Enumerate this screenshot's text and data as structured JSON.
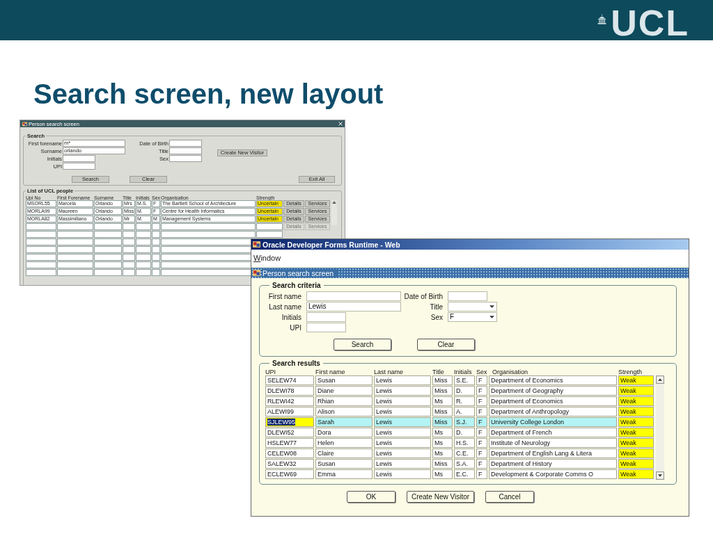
{
  "slide": {
    "logo": "UCL",
    "title": "Search screen, new layout"
  },
  "old_window": {
    "title": "Person search screen",
    "search": {
      "legend": "Search",
      "left_fields": [
        {
          "label": "First forename",
          "value": "m*",
          "kind": "long"
        },
        {
          "label": "Surname",
          "value": "orlando",
          "kind": "long"
        },
        {
          "label": "Initials",
          "kind": "short"
        },
        {
          "label": "UPI",
          "kind": "short"
        }
      ],
      "right_fields": [
        {
          "label": "Date of Birth",
          "kind": "short"
        },
        {
          "label": "Title",
          "kind": "short"
        },
        {
          "label": "Sex",
          "kind": "short"
        }
      ],
      "side_button": "Create New Visitor",
      "buttons": [
        "Search",
        "Clear"
      ],
      "exit_button": "Exit All"
    },
    "list": {
      "legend": "List of UCL people",
      "columns": [
        "Upi No",
        "First Forename",
        "Surname",
        "Title",
        "Initials",
        "Sex",
        "Organisation",
        "Strength"
      ],
      "rows": [
        {
          "cells": [
            "MSORL55",
            "Marcela",
            "Orlando",
            "Mrs",
            "M.S.",
            "F",
            "The Bartlett School of Architecture",
            "Uncertain"
          ],
          "actions": [
            {
              "label": "Details",
              "disabled": false
            },
            {
              "label": "Services",
              "disabled": false
            }
          ]
        },
        {
          "cells": [
            "MORLA99",
            "Maureen",
            "Orlando",
            "Miss",
            "M.",
            "F",
            "Centre for Health Informatics",
            "Uncertain"
          ],
          "actions": [
            {
              "label": "Details",
              "disabled": false
            },
            {
              "label": "Services",
              "disabled": false
            }
          ]
        },
        {
          "cells": [
            "MORLA82",
            "Massimiliano",
            "Orlando",
            "Mr",
            "M.",
            "M",
            "Management Systems",
            "Uncertain"
          ],
          "actions": [
            {
              "label": "Details",
              "disabled": false
            },
            {
              "label": "Services",
              "disabled": false
            }
          ]
        },
        {
          "actions": [
            {
              "label": "Details",
              "disabled": true
            },
            {
              "label": "Services",
              "disabled": true
            }
          ]
        }
      ]
    }
  },
  "new_window": {
    "title": "Oracle Developer Forms Runtime - Web",
    "menu": [
      "Window"
    ],
    "form_title": "Person search screen",
    "criteria": {
      "legend": "Search criteria",
      "left_fields": [
        {
          "label": "First name",
          "kind": "long"
        },
        {
          "label": "Last name",
          "value": "Lewis",
          "kind": "long"
        },
        {
          "label": "Initials",
          "kind": "short"
        },
        {
          "label": "UPI",
          "kind": "short"
        }
      ],
      "right_fields": [
        {
          "label": "Date of Birth",
          "kind": "short"
        },
        {
          "label": "Title",
          "kind": "dropdown"
        },
        {
          "label": "Sex",
          "value": "F",
          "kind": "dropdown"
        }
      ],
      "buttons": [
        "Search",
        "Clear"
      ]
    },
    "results": {
      "legend": "Search results",
      "columns": [
        "UPI",
        "First name",
        "Last name",
        "Title",
        "Initials",
        "Sex",
        "Organisation",
        "Strength"
      ],
      "rows": [
        {
          "cells": [
            "SELEW74",
            "Susan",
            "Lewis",
            "Miss",
            "S.E.",
            "F",
            "Department of Economics",
            "Weak"
          ],
          "selected": false
        },
        {
          "cells": [
            "DLEWI78",
            "Diane",
            "Lewis",
            "Miss",
            "D.",
            "F",
            "Department of Geography",
            "Weak"
          ],
          "selected": false
        },
        {
          "cells": [
            "RLEWI42",
            "Rhian",
            "Lewis",
            "Ms",
            "R.",
            "F",
            "Department of Economics",
            "Weak"
          ],
          "selected": false
        },
        {
          "cells": [
            "ALEWI99",
            "Alison",
            "Lewis",
            "Miss",
            "A.",
            "F",
            "Department of Anthropology",
            "Weak"
          ],
          "selected": false
        },
        {
          "cells": [
            "SJLEW95",
            "Sarah",
            "Lewis",
            "Miss",
            "S.J.",
            "F",
            "University College London",
            "Weak"
          ],
          "selected": true
        },
        {
          "cells": [
            "DLEWI52",
            "Dora",
            "Lewis",
            "Ms",
            "D.",
            "F",
            "Department of French",
            "Weak"
          ],
          "selected": false
        },
        {
          "cells": [
            "HSLEW77",
            "Helen",
            "Lewis",
            "Ms",
            "H.S.",
            "F",
            "Institute of Neurology",
            "Weak"
          ],
          "selected": false
        },
        {
          "cells": [
            "CELEW08",
            "Claire",
            "Lewis",
            "Ms",
            "C.E.",
            "F",
            "Department of English Lang & Litera",
            "Weak"
          ],
          "selected": false
        },
        {
          "cells": [
            "SALEW32",
            "Susan",
            "Lewis",
            "Miss",
            "S.A.",
            "F",
            "Department of History",
            "Weak"
          ],
          "selected": false
        },
        {
          "cells": [
            "ECLEW69",
            "Emma",
            "Lewis",
            "Ms",
            "E.C.",
            "F",
            "Development & Corporate Comms O",
            "Weak"
          ],
          "selected": false
        }
      ]
    },
    "buttons": [
      "OK",
      "Create New Visitor",
      "Cancel"
    ]
  }
}
